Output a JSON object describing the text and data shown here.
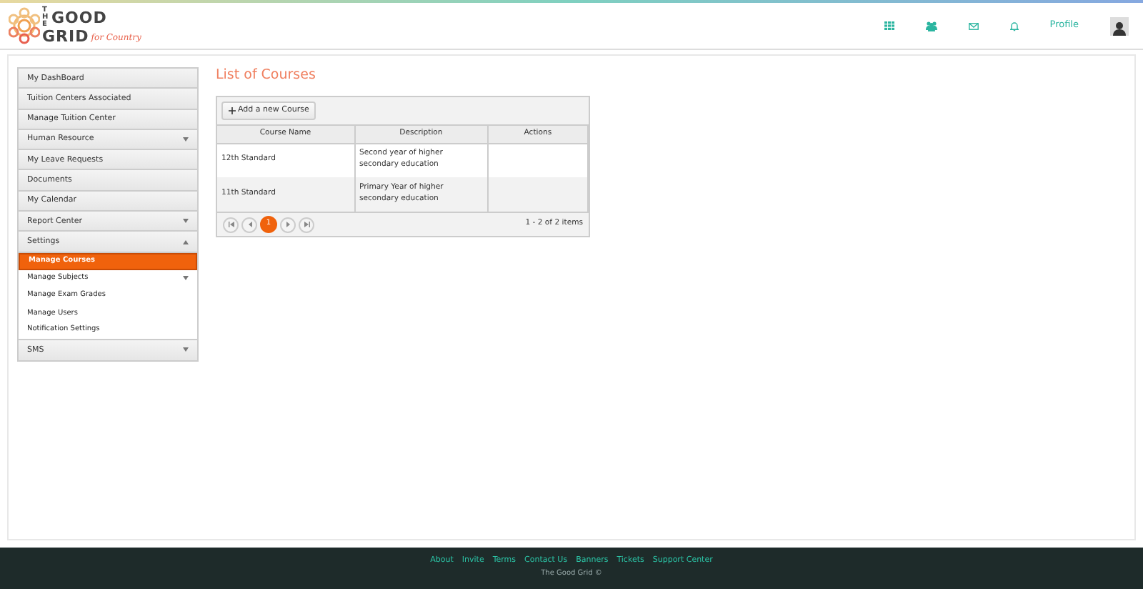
{
  "logo": {
    "the": "THE",
    "good": "GOOD",
    "grid": "GRID",
    "tagline": "for Country"
  },
  "header": {
    "profile": "Profile"
  },
  "sidebar": {
    "items": [
      {
        "label": "My DashBoard",
        "kind": "link"
      },
      {
        "label": "Tuition Centers Associated",
        "kind": "link"
      },
      {
        "label": "Manage Tuition Center",
        "kind": "link"
      },
      {
        "label": "Human Resource",
        "kind": "group",
        "expanded": false
      },
      {
        "label": "My Leave Requests",
        "kind": "link"
      },
      {
        "label": "Documents",
        "kind": "link"
      },
      {
        "label": "My Calendar",
        "kind": "link"
      },
      {
        "label": "Report Center",
        "kind": "group",
        "expanded": false
      },
      {
        "label": "Settings",
        "kind": "group",
        "expanded": true,
        "children": [
          {
            "label": "Manage Courses",
            "selected": true,
            "kind": "link"
          },
          {
            "label": "Manage Subjects",
            "selected": false,
            "kind": "group",
            "expanded": false
          },
          {
            "label": "Manage Exam Grades",
            "selected": false,
            "kind": "link"
          },
          {
            "label": "Manage Users",
            "selected": false,
            "kind": "link"
          },
          {
            "label": "Notification Settings",
            "selected": false,
            "kind": "link"
          }
        ]
      },
      {
        "label": "SMS",
        "kind": "group",
        "expanded": false
      }
    ]
  },
  "main": {
    "title": "List of Courses",
    "add_button": "Add a new Course",
    "table": {
      "columns": [
        "Course Name",
        "Description",
        "Actions"
      ],
      "rows": [
        [
          "12th Standard",
          "Second year of higher secondary education",
          ""
        ],
        [
          "11th Standard",
          "Primary Year of higher secondary education",
          ""
        ]
      ]
    },
    "pager": {
      "pages": [
        {
          "label": "1",
          "selected": true
        }
      ],
      "summary": "1 - 2 of 2 items"
    }
  },
  "footer": {
    "links": [
      "About",
      "Invite",
      "Terms",
      "Contact Us",
      "Banners",
      "Tickets",
      "Support Center"
    ],
    "copyright": "The Good Grid ©"
  }
}
